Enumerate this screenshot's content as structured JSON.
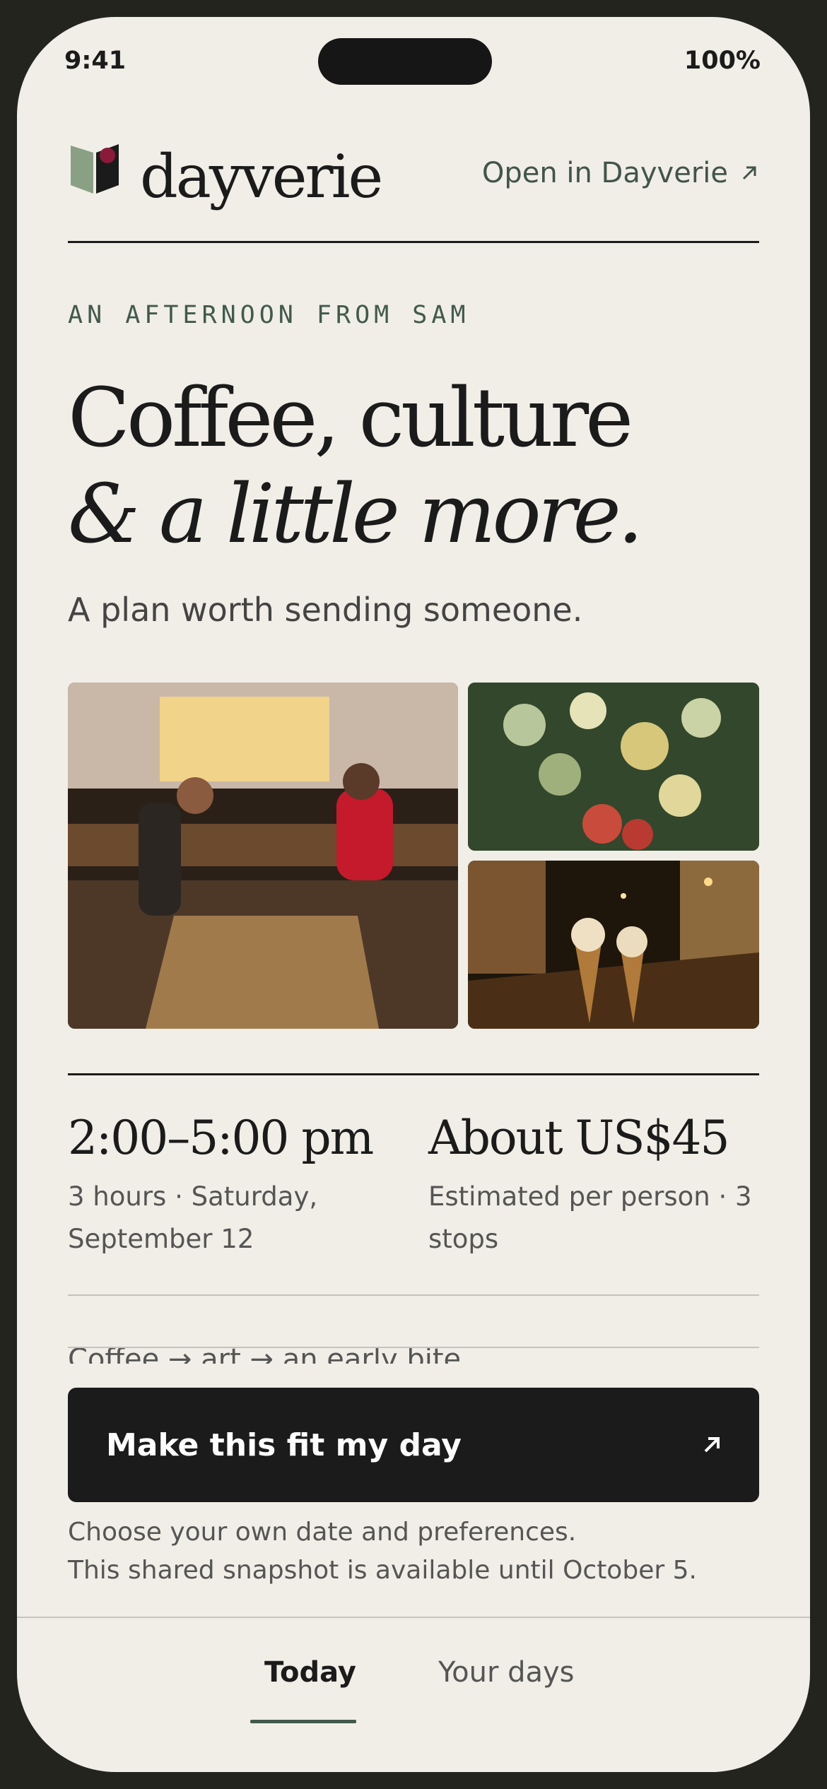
{
  "status_bar": {
    "time": "9:41",
    "battery": "100%"
  },
  "header": {
    "brand": "dayverie",
    "open_link": "Open in Dayverie"
  },
  "hero": {
    "eyebrow": "AN AFTERNOON FROM SAM",
    "headline_line1": "Coffee, culture",
    "headline_line2": "& a little more.",
    "subheadline": "A plan worth sending someone."
  },
  "photos": [
    {
      "name": "cafe-photo",
      "description": ""
    },
    {
      "name": "flowers-painting-photo",
      "description": ""
    },
    {
      "name": "ice-cream-street-photo",
      "description": ""
    }
  ],
  "details": {
    "time_range": "2:00–5:00 pm",
    "time_detail": "3 hours · Saturday, September 12",
    "price": "About US$45",
    "price_detail": "Estimated per person · 3 stops",
    "route": "Coffee → art → an early bite"
  },
  "cta": {
    "label": "Make this fit my day",
    "note_line1": "Choose your own date and preferences.",
    "note_line2": "This shared snapshot is available until October 5."
  },
  "tabs": {
    "active": "Today",
    "other": "Your days"
  },
  "colors": {
    "background": "#f0eee6",
    "ink": "#1b1b1b",
    "accent": "#42594b",
    "logo_red": "#8a1a3a"
  }
}
